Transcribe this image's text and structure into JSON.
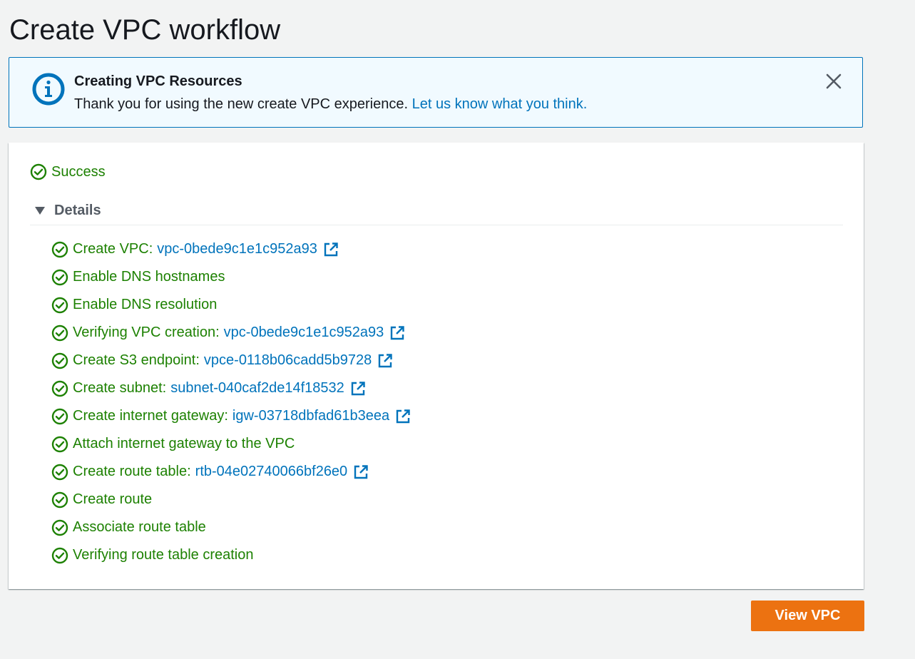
{
  "page": {
    "title": "Create VPC workflow"
  },
  "flash": {
    "title": "Creating VPC Resources",
    "body": "Thank you for using the new create VPC experience.",
    "link": "Let us know what you think.",
    "icon": "info-icon",
    "close_icon": "close-icon"
  },
  "status": {
    "label": "Success",
    "icon": "check-circle-icon"
  },
  "details": {
    "label": "Details",
    "icon": "caret-down-icon"
  },
  "steps": [
    {
      "label": "Create VPC:",
      "resource": "vpc-0bede9c1e1c952a93"
    },
    {
      "label": "Enable DNS hostnames"
    },
    {
      "label": "Enable DNS resolution"
    },
    {
      "label": "Verifying VPC creation:",
      "resource": "vpc-0bede9c1e1c952a93"
    },
    {
      "label": "Create S3 endpoint:",
      "resource": "vpce-0118b06cadd5b9728"
    },
    {
      "label": "Create subnet:",
      "resource": "subnet-040caf2de14f18532"
    },
    {
      "label": "Create internet gateway:",
      "resource": "igw-03718dbfad61b3eea"
    },
    {
      "label": "Attach internet gateway to the VPC"
    },
    {
      "label": "Create route table:",
      "resource": "rtb-04e02740066bf26e0"
    },
    {
      "label": "Create route"
    },
    {
      "label": "Associate route table"
    },
    {
      "label": "Verifying route table creation"
    }
  ],
  "actions": {
    "view_vpc_label": "View VPC"
  },
  "colors": {
    "success": "#1d8102",
    "link": "#0073bb",
    "primary_button": "#ec7211",
    "info_background": "#f1faff",
    "info_border": "#0073bb"
  }
}
